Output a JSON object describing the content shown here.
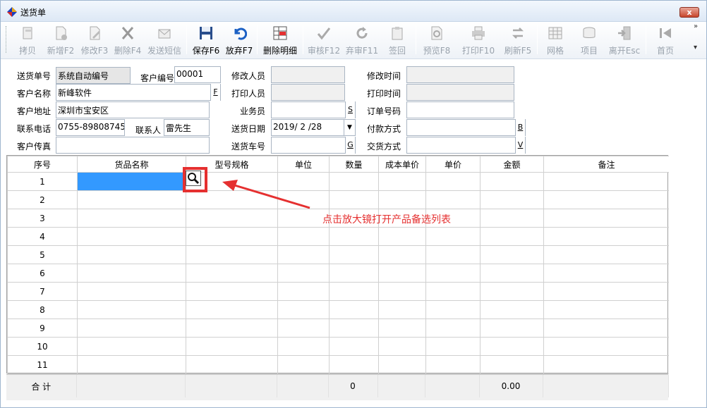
{
  "window": {
    "title": "送货单",
    "close_label": "x"
  },
  "toolbar": {
    "copy": "拷贝",
    "add": "新增F2",
    "edit": "修改F3",
    "delete": "删除F4",
    "sms": "发送短信",
    "save": "保存F6",
    "discard": "放弃F7",
    "delete_detail": "删除明细",
    "audit": "审核F12",
    "unaudit": "弃审F11",
    "sign": "签回",
    "preview": "预览F8",
    "print": "打印F10",
    "refresh": "刷新F5",
    "grid": "网格",
    "item": "项目",
    "exit": "离开Esc",
    "first": "首页"
  },
  "form": {
    "order_no_label": "送货单号",
    "order_no_value": "系统自动编号",
    "customer_no_label": "客户编号",
    "customer_no_value": "00001",
    "customer_name_label": "客户名称",
    "customer_name_value": "新峰软件",
    "customer_name_btn": "F",
    "address_label": "客户地址",
    "address_value": "深圳市宝安区",
    "phone_label": "联系电话",
    "phone_value": "0755-89808745",
    "contact_label": "联系人",
    "contact_value": "雷先生",
    "fax_label": "客户传真",
    "fax_value": "",
    "modifier_label": "修改人员",
    "printer_label": "打印人员",
    "salesman_label": "业务员",
    "salesman_btn": "S",
    "date_label": "送货日期",
    "date_value": "2019/ 2 /28",
    "vehicle_label": "送货车号",
    "vehicle_btn": "G",
    "modify_time_label": "修改时间",
    "print_time_label": "打印时间",
    "order_code_label": "订单号码",
    "payment_label": "付款方式",
    "payment_btn": "B",
    "delivery_label": "交货方式",
    "delivery_btn": "V"
  },
  "grid": {
    "columns": [
      "序号",
      "货品名称",
      "型号规格",
      "单位",
      "数量",
      "成本单价",
      "单价",
      "金额",
      "备注"
    ],
    "rows": [
      "1",
      "2",
      "3",
      "4",
      "5",
      "6",
      "7",
      "8",
      "9",
      "10",
      "11"
    ]
  },
  "summary": {
    "label": "合 计",
    "qty": "0",
    "amount": "0.00"
  },
  "annotation": "点击放大镜打开产品备选列表",
  "colors": {
    "accent": "#e53030",
    "selection": "#3399ff"
  }
}
